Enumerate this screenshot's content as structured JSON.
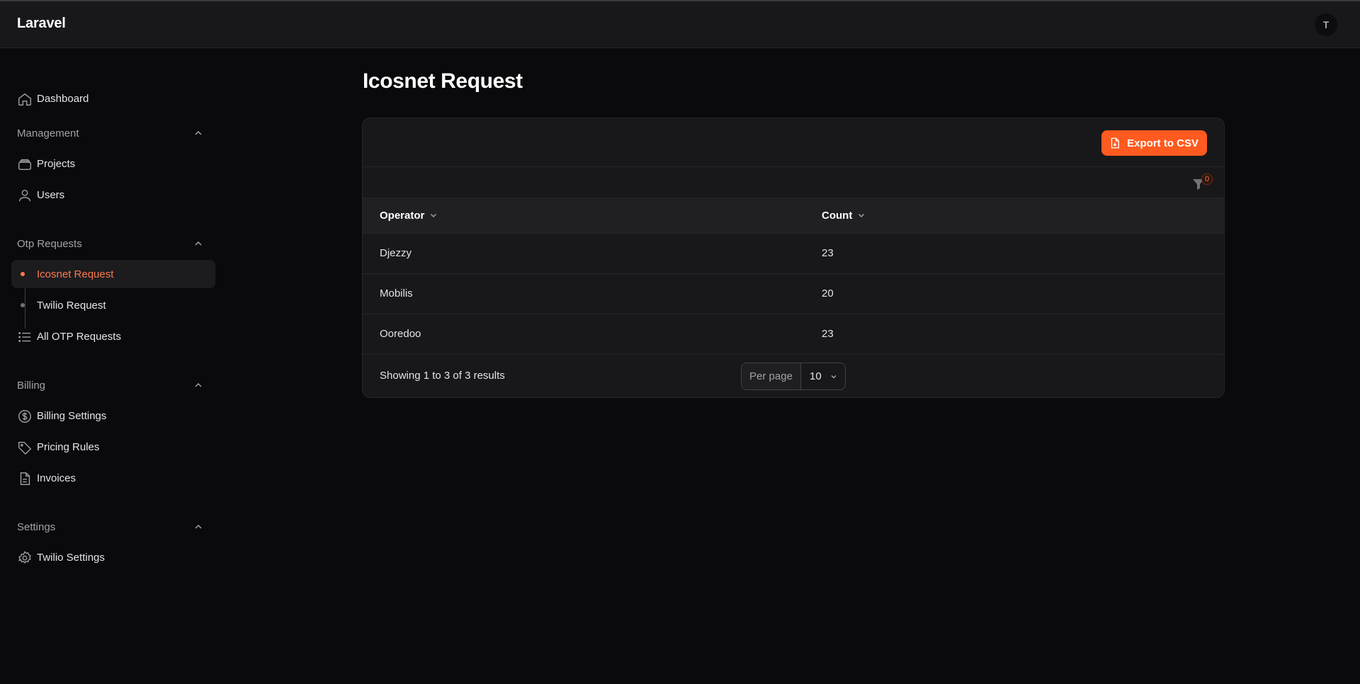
{
  "app": {
    "brand": "Laravel",
    "user_initial": "T"
  },
  "sidebar": {
    "dashboard": "Dashboard",
    "groups": [
      {
        "label": "Management",
        "items": [
          "Projects",
          "Users"
        ]
      },
      {
        "label": "Otp Requests",
        "items": [
          "Icosnet Request",
          "Twilio Request",
          "All OTP Requests"
        ]
      },
      {
        "label": "Billing",
        "items": [
          "Billing Settings",
          "Pricing Rules",
          "Invoices"
        ]
      },
      {
        "label": "Settings",
        "items": [
          "Twilio Settings"
        ]
      }
    ],
    "active_item": "Icosnet Request"
  },
  "page": {
    "title": "Icosnet Request"
  },
  "toolbar": {
    "export_label": "Export to CSV",
    "filter_count": "0"
  },
  "table": {
    "columns": [
      "Operator",
      "Count"
    ],
    "rows": [
      [
        "Djezzy",
        "23"
      ],
      [
        "Mobilis",
        "20"
      ],
      [
        "Ooredoo",
        "23"
      ]
    ]
  },
  "pagination": {
    "summary": "Showing 1 to 3 of 3 results",
    "per_page_label": "Per page",
    "per_page_value": "10"
  },
  "colors": {
    "accent": "#ff5a1f",
    "active_text": "#fb7a4f"
  }
}
